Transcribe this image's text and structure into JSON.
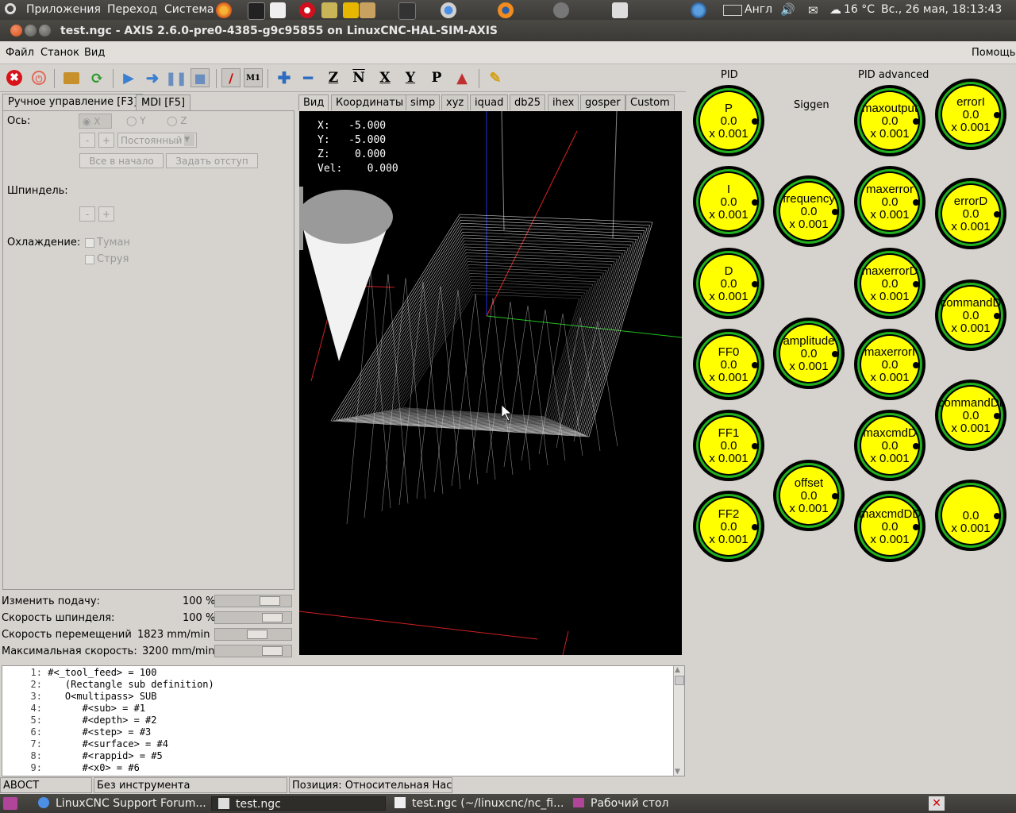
{
  "panel": {
    "menus": [
      "Приложения",
      "Переход",
      "Система"
    ],
    "layout": "Англ",
    "weather": "16 °C",
    "clock": "Вс., 26 мая, 18:13:43"
  },
  "window": {
    "title": "test.ngc - AXIS 2.6.0-pre0-4385-g9c95855 on LinuxCNC-HAL-SIM-AXIS"
  },
  "menubar": {
    "file": "Файл",
    "machine": "Станок",
    "view": "Вид",
    "help": "Помощь"
  },
  "toolbar": {
    "icons": [
      "estop-icon",
      "power-icon",
      "open-icon",
      "reload-icon",
      "run-icon",
      "step-icon",
      "pause-icon",
      "stop-icon",
      "block-delete-icon",
      "optional-stop-icon",
      "zoom-in-icon",
      "zoom-out-icon",
      "view-z-icon",
      "view-z2-icon",
      "view-x-icon",
      "view-y-icon",
      "view-p-icon",
      "rotate-icon",
      "clear-plot-icon"
    ]
  },
  "left_tabs": [
    "Ручное управление [F3]",
    "MDI [F5]"
  ],
  "manual": {
    "axis_label": "Ось:",
    "axes": [
      "X",
      "Y",
      "Z"
    ],
    "minus": "-",
    "plus": "+",
    "increment": "Постоянный",
    "home_all": "Все в начало",
    "touch_off": "Задать отступ",
    "spindle_label": "Шпиндель:",
    "coolant_label": "Охлаждение:",
    "mist": "Туман",
    "flood": "Струя"
  },
  "overrides": [
    {
      "label": "Изменить подачу:",
      "value": "100 %",
      "level": 0.8
    },
    {
      "label": "Скорость шпинделя:",
      "value": "100 %",
      "level": 0.84
    },
    {
      "label": "Скорость перемещений",
      "value": "1823 mm/min",
      "level": 0.57
    },
    {
      "label": "Максимальная скорость:",
      "value": "3200 mm/min",
      "level": 0.84
    }
  ],
  "right_tabs": [
    "Вид",
    "Координаты",
    "simp",
    "xyz",
    "iquad",
    "db25",
    "ihex",
    "gosper",
    "Custom"
  ],
  "dro": {
    "x_label": "X:",
    "x": "-5.000",
    "y_label": "Y:",
    "y": "-5.000",
    "z_label": "Z:",
    "z": "0.000",
    "vel_label": "Vel:",
    "vel": "0.000"
  },
  "code": [
    {
      "n": "1:",
      "text": "#<_tool_feed> = 100"
    },
    {
      "n": "2:",
      "text": "   (Rectangle sub definition)"
    },
    {
      "n": "3:",
      "text": "   O<multipass> SUB"
    },
    {
      "n": "4:",
      "text": "      #<sub> = #1"
    },
    {
      "n": "5:",
      "text": "      #<depth> = #2"
    },
    {
      "n": "6:",
      "text": "      #<step> = #3"
    },
    {
      "n": "7:",
      "text": "      #<surface> = #4"
    },
    {
      "n": "8:",
      "text": "      #<rappid> = #5"
    },
    {
      "n": "9:",
      "text": "      #<x0> = #6"
    }
  ],
  "status": {
    "estop": "АВОСТ",
    "tool": "Без инструмента",
    "position": "Позиция: Относительная Насто"
  },
  "gauges": {
    "headers": {
      "pid": "PID",
      "siggen": "Siggen",
      "pid_adv": "PID advanced"
    },
    "value": "0.0",
    "scale": "x 0.001",
    "items": [
      {
        "name": "P"
      },
      {
        "name": "I"
      },
      {
        "name": "D"
      },
      {
        "name": "FF0"
      },
      {
        "name": "FF1"
      },
      {
        "name": "FF2"
      },
      {
        "name": "frequency"
      },
      {
        "name": "amplitude"
      },
      {
        "name": "offset"
      },
      {
        "name": "maxoutput"
      },
      {
        "name": "maxerror"
      },
      {
        "name": "maxerrorD"
      },
      {
        "name": "maxerrorI"
      },
      {
        "name": "maxcmdD"
      },
      {
        "name": "maxcmdDD"
      },
      {
        "name": "errorI"
      },
      {
        "name": "errorD"
      },
      {
        "name": "commandD"
      },
      {
        "name": "commandDD"
      },
      {
        "name": ""
      }
    ]
  },
  "taskbar": [
    "LinuxCNC Support Forum...",
    "test.ngc",
    "test.ngc (~/linuxcnc/nc_fi...",
    "Рабочий стол"
  ]
}
